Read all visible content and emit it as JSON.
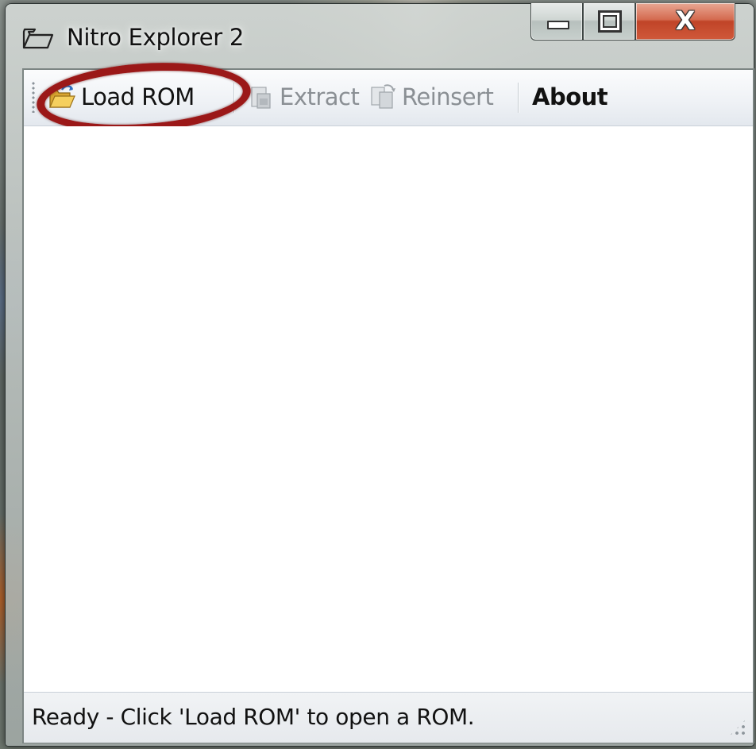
{
  "window": {
    "title": "Nitro Explorer 2",
    "close_glyph": "X"
  },
  "toolbar": {
    "items": [
      {
        "label": "Load ROM",
        "icon": "open-folder-icon",
        "enabled": true,
        "highlighted": true
      },
      {
        "label": "Extract",
        "icon": "extract-icon",
        "enabled": false
      },
      {
        "label": "Reinsert",
        "icon": "reinsert-icon",
        "enabled": false
      },
      {
        "label": "About",
        "enabled": true
      }
    ]
  },
  "statusbar": {
    "text": "Ready - Click 'Load ROM' to open a ROM."
  },
  "colors": {
    "highlight_ring": "#9b1818",
    "disabled_text": "#8a8f94",
    "close_button": "#c04428"
  }
}
